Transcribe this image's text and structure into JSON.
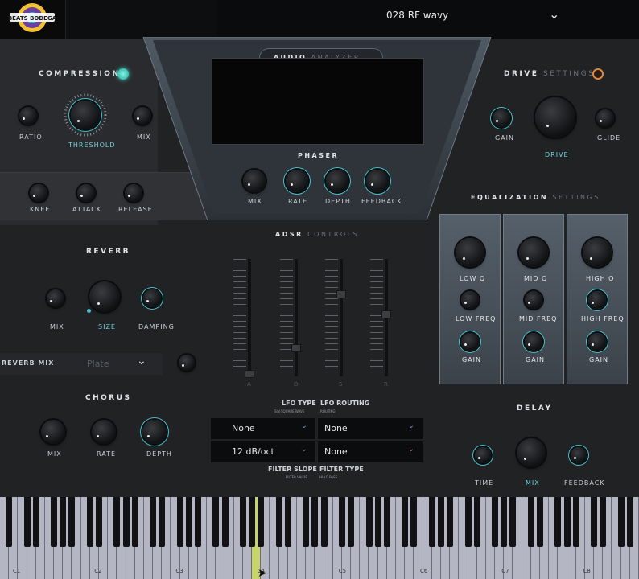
{
  "header": {
    "logo_text": "BEATS BODEGA",
    "preset_name": "028 RF wavy"
  },
  "compression": {
    "title": "COMPRESSION",
    "knobs": [
      "RATIO",
      "THRESHOLD",
      "MIX",
      "KNEE",
      "ATTACK",
      "RELEASE"
    ]
  },
  "analyzer": {
    "title_bold": "AUDIO",
    "title_dim": "ANALYZER"
  },
  "phaser": {
    "title": "PHASER",
    "knobs": [
      "MIX",
      "RATE",
      "DEPTH",
      "FEEDBACK"
    ]
  },
  "drive": {
    "title_bold": "DRIVE",
    "title_dim": "SETTINGS",
    "knobs": [
      "GAIN",
      "DRIVE",
      "GLIDE"
    ]
  },
  "reverb": {
    "title": "REVERB",
    "knobs": [
      "MIX",
      "SIZE",
      "DAMPING"
    ],
    "mix_label": "REVERB MIX",
    "type_value": "Plate"
  },
  "adsr": {
    "title_bold": "ADSR",
    "title_dim": "CONTROLS",
    "faders": [
      "A",
      "D",
      "S",
      "R"
    ]
  },
  "equalization": {
    "title_bold": "EQUALIZATION",
    "title_dim": "SETTINGS",
    "strips": [
      [
        "LOW Q",
        "LOW FREQ",
        "GAIN"
      ],
      [
        "MID Q",
        "MID FREQ",
        "GAIN"
      ],
      [
        "HIGH Q",
        "HIGH FREQ",
        "GAIN"
      ]
    ]
  },
  "chorus": {
    "title": "CHORUS",
    "knobs": [
      "MIX",
      "RATE",
      "DEPTH"
    ]
  },
  "lfo": {
    "type_label": "LFO TYPE",
    "type_sub": "SIN SQUARE WAVE",
    "routing_label": "LFO ROUTING",
    "routing_sub": "ROUTING",
    "lfo_type_value": "None",
    "lfo_routing_value": "None",
    "filter_slope_value": "12 dB/oct",
    "filter_type_value": "None",
    "slope_label": "FILTER SLOPE",
    "slope_sub": "FILTER VALUE",
    "ftype_label": "FILTER TYPE",
    "ftype_sub": "HI-LO PASS"
  },
  "delay": {
    "title": "DELAY",
    "knobs": [
      "TIME",
      "MIX",
      "FEEDBACK"
    ]
  },
  "keyboard": {
    "octaves": [
      "C1",
      "C2",
      "C3",
      "C4",
      "C5",
      "C6",
      "C7",
      "C8"
    ]
  },
  "colors": {
    "accent": "#46c3cf",
    "led_compression": "#3fd9c8",
    "led_drive": "#e08a3c"
  },
  "icons": {
    "chevron": "chevron-down-icon"
  }
}
